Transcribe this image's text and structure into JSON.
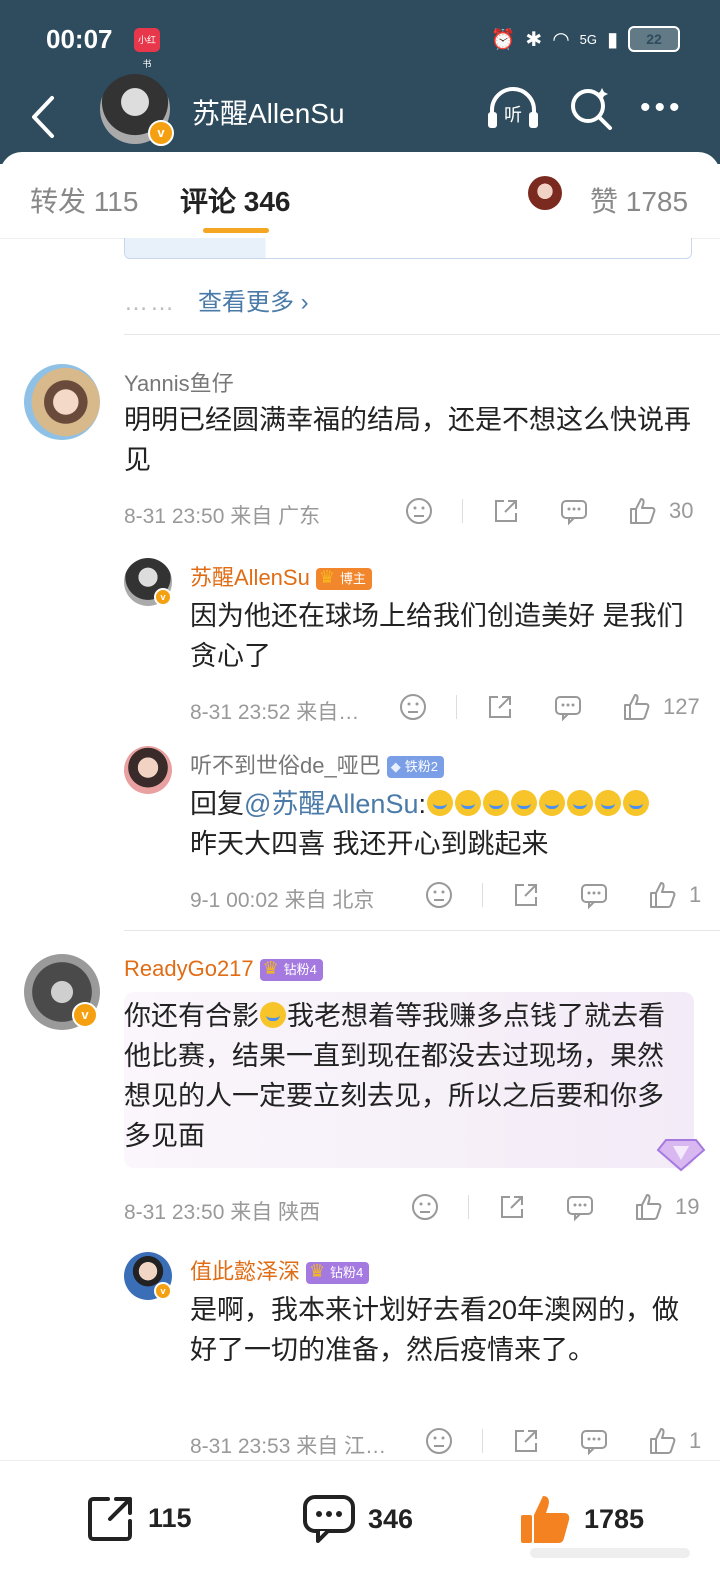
{
  "status_bar": {
    "time": "00:07",
    "app_badge": "小红书",
    "network": "5G",
    "battery": "22"
  },
  "header": {
    "title": "苏醒AllenSu"
  },
  "tabs": [
    {
      "label": "转发 115"
    },
    {
      "label": "评论 346"
    },
    {
      "label": "赞 1785"
    }
  ],
  "more_link": {
    "dots": "……",
    "label": "查看更多 ›"
  },
  "comments": [
    {
      "name": "Yannis鱼仔",
      "text": "明明已经圆满幸福的结局，还是不想这么快说再见",
      "meta": "8-31 23:50  来自 广东",
      "likes": "30",
      "replies": [
        {
          "name": "苏醒AllenSu",
          "tag": "博主",
          "text": "因为他还在球场上给我们创造美好 是我们贪心了",
          "meta": "8-31 23:52  来自…",
          "likes": "127"
        },
        {
          "name": "听不到世俗de_哑巴",
          "tag": "铁粉2",
          "text_prefix": "回复",
          "mention": "@苏醒AllenSu",
          "text_suffix": ":",
          "text_line2": "昨天大四喜 我还开心到跳起来",
          "meta": "9-1 00:02  来自 北京",
          "likes": "1"
        }
      ]
    },
    {
      "name": "ReadyGo217",
      "tag": "钻粉4",
      "text_a": "你还有合影",
      "text_b": "我老想着等我赚多点钱了就去看他比赛，结果一直到现在都没去过现场，果然想见的人一定要立刻去见，所以之后要和你多多见面",
      "meta": "8-31 23:50  来自 陕西",
      "likes": "19",
      "replies": [
        {
          "name": "值此懿泽深",
          "tag": "钻粉4",
          "text": "是啊，我本来计划好去看20年澳网的，做好了一切的准备，然后疫情来了。",
          "meta": "8-31 23:53  来自 江…",
          "likes": "1"
        }
      ]
    }
  ],
  "bottom_bar": {
    "repost": "115",
    "comment": "346",
    "like": "1785"
  },
  "colors": {
    "header_bg": "#2e4c5e",
    "accent": "#f5a623",
    "name_orange": "#e06d15",
    "link_blue": "#4a7aa8"
  },
  "icons": [
    "back-icon",
    "listen-icon",
    "search-icon",
    "more-icon",
    "share-icon",
    "comment-icon",
    "like-icon",
    "dislike-icon"
  ]
}
